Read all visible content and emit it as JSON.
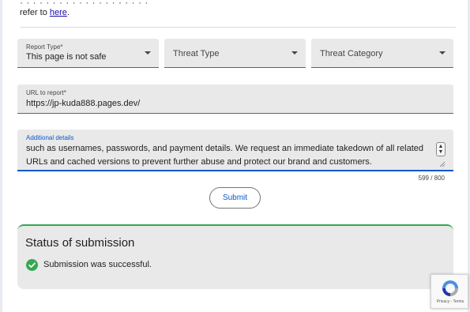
{
  "header": {
    "clipped_text": "· · · · · · · · · · · · · · · · · · · ·",
    "refer_prefix": "refer to ",
    "refer_link": "here",
    "refer_suffix": "."
  },
  "form": {
    "report_type": {
      "label": "Report Type*",
      "value": "This page is not safe"
    },
    "threat_type": {
      "placeholder": "Threat Type"
    },
    "threat_category": {
      "placeholder": "Threat Category"
    },
    "url": {
      "label": "URL to report*",
      "value": "https://jp-kuda888.pages.dev/"
    },
    "details": {
      "label": "Additional details",
      "line1": "such as usernames, passwords, and payment details. We request an immediate takedown of all related",
      "line2": "URLs and cached versions to prevent further abuse and protect our brand and customers.",
      "char_count": "599 / 800"
    },
    "submit_label": "Submit"
  },
  "status": {
    "title": "Status of submission",
    "message": "Submission was successful.",
    "color": "#34a853"
  },
  "recaptcha": {
    "terms": "Privacy - Terms"
  },
  "colors": {
    "accent": "#0b57d0",
    "success": "#34a853",
    "field_bg": "#e9e9e9"
  }
}
